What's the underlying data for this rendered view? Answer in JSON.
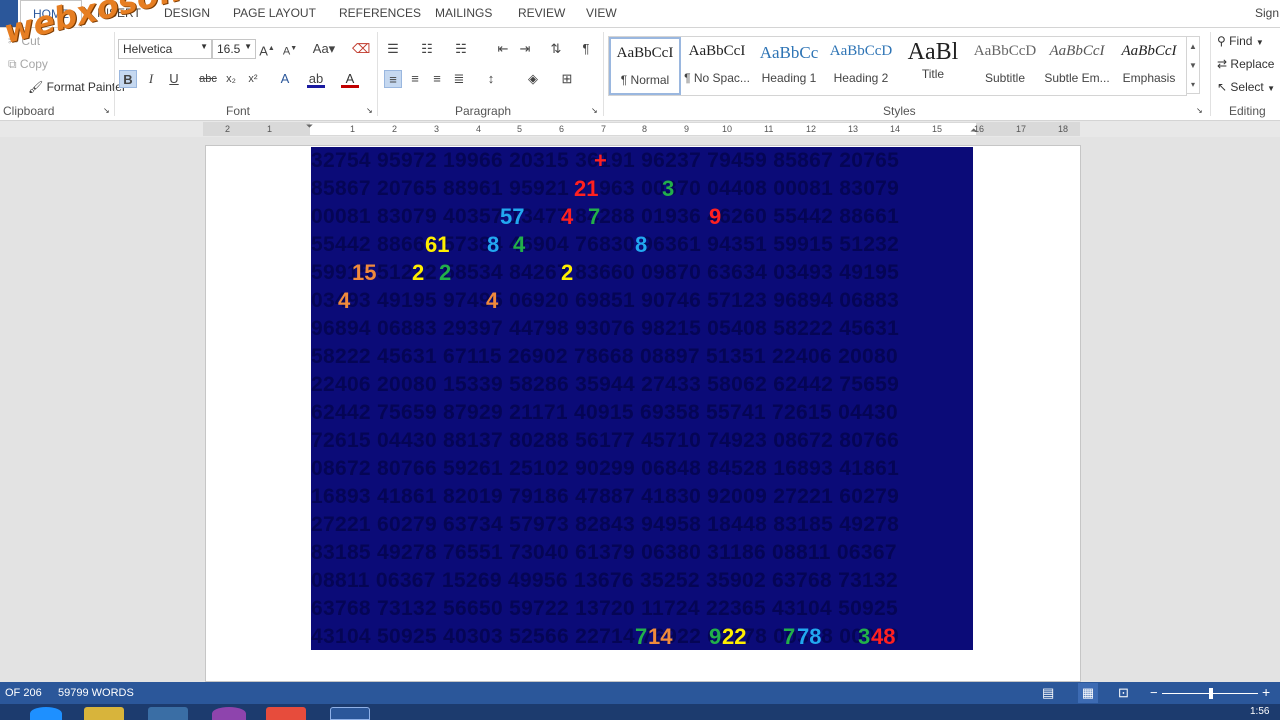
{
  "tabs": [
    "HOME",
    "INSERT",
    "DESIGN",
    "PAGE LAYOUT",
    "REFERENCES",
    "MAILINGS",
    "REVIEW",
    "VIEW"
  ],
  "sign_in": "Sign",
  "clipboard": {
    "cut": "Cut",
    "copy": "Copy",
    "format_painter": "Format Painter",
    "label": "Clipboard"
  },
  "font": {
    "name": "Helvetica",
    "size": "16.5",
    "label": "Font"
  },
  "paragraph": {
    "label": "Paragraph"
  },
  "styles": {
    "label": "Styles",
    "items": [
      {
        "preview": "AaBbCcI",
        "name": "¶ Normal"
      },
      {
        "preview": "AaBbCcI",
        "name": "¶ No Spac..."
      },
      {
        "preview": "AaBbCc",
        "name": "Heading 1"
      },
      {
        "preview": "AaBbCcD",
        "name": "Heading 2"
      },
      {
        "preview": "AaBl",
        "name": "Title"
      },
      {
        "preview": "AaBbCcD",
        "name": "Subtitle"
      },
      {
        "preview": "AaBbCcI",
        "name": "Subtle Em..."
      },
      {
        "preview": "AaBbCcI",
        "name": "Emphasis"
      }
    ]
  },
  "editing": {
    "find": "Find",
    "replace": "Replace",
    "select": "Select",
    "label": "Editing"
  },
  "ruler_numbers": [
    "2",
    "1",
    "1",
    "2",
    "3",
    "4",
    "5",
    "6",
    "7",
    "8",
    "9",
    "10",
    "11",
    "12",
    "13",
    "14",
    "15",
    "16",
    "17",
    "18"
  ],
  "grid_rows": [
    "32754 95972 19966 20315 36191 96237 79459 85867 20765",
    "85867 20765 88961 95921 71963 00370 04408 00081 83079",
    "00081 83079 40357 13477 84288 01936 46260 55442 88661",
    "55442 88661 57384 46904 76830 96361 94351 59915 51232",
    "59915 51232 58534 84267 83660 09870 63634 03493 49195",
    "03493 49195 97495 06920 69851 90746 57123 96894 06883",
    "96894 06883 29397 44798 93076 98215 05408 58222 45631",
    "58222 45631 67115 26902 78668 08897 51351 22406 20080",
    "22406 20080 15339 58286 35944 27433 58062 62442 75659",
    "62442 75659 87929 21171 40915 69358 55741 72615 04430",
    "72615 04430 88137 80288 56177 45710 74923 08672 80766",
    "08672 80766 59261 25102 90299 06848 84528 16893 41861",
    "16893 41861 82019 79186 47887 41830 92009 27221 60279",
    "27221 60279 63734 57973 82843 94958 18448 83185 49278",
    "83185 49278 76551 73040 61379 06380 31186 08811 06367",
    "08811 06367 15269 49956 13676 35252 35902 63768 73132",
    "63768 73132 56650 59722 13720 11724 22365 43104 50925",
    "43104 50925 40303 52566 22714 76922 62778 00348 00000"
  ],
  "highlights": [
    {
      "text": "+",
      "color": "#ff2020",
      "row": 0,
      "col": 594
    },
    {
      "text": "21",
      "color": "#ff2020",
      "row": 1,
      "col": 574
    },
    {
      "text": "3",
      "color": "#22b04a",
      "row": 1,
      "col": 662
    },
    {
      "text": "57",
      "color": "#22a8f0",
      "row": 2,
      "col": 500
    },
    {
      "text": "4",
      "color": "#ff2020",
      "row": 2,
      "col": 561
    },
    {
      "text": "7",
      "color": "#22b04a",
      "row": 2,
      "col": 588
    },
    {
      "text": "9",
      "color": "#ff2020",
      "row": 2,
      "col": 709
    },
    {
      "text": "61",
      "color": "#ffee00",
      "row": 3,
      "col": 425
    },
    {
      "text": "8",
      "color": "#22a8f0",
      "row": 3,
      "col": 487
    },
    {
      "text": "4",
      "color": "#22b04a",
      "row": 3,
      "col": 513
    },
    {
      "text": "8",
      "color": "#22a8f0",
      "row": 3,
      "col": 635
    },
    {
      "text": "15",
      "color": "#f08a3c",
      "row": 4,
      "col": 352
    },
    {
      "text": "2",
      "color": "#ffee00",
      "row": 4,
      "col": 412
    },
    {
      "text": "2",
      "color": "#22b04a",
      "row": 4,
      "col": 439
    },
    {
      "text": "2",
      "color": "#ffee00",
      "row": 4,
      "col": 561
    },
    {
      "text": "4",
      "color": "#f08a3c",
      "row": 5,
      "col": 338
    },
    {
      "text": "4",
      "color": "#f08a3c",
      "row": 5,
      "col": 486
    },
    {
      "text": "7",
      "color": "#22b04a",
      "row": 17,
      "col": 635
    },
    {
      "text": "14",
      "color": "#f08a3c",
      "row": 17,
      "col": 648
    },
    {
      "text": "9",
      "color": "#22b04a",
      "row": 17,
      "col": 709
    },
    {
      "text": "22",
      "color": "#ffee00",
      "row": 17,
      "col": 722
    },
    {
      "text": "7",
      "color": "#22b04a",
      "row": 17,
      "col": 783
    },
    {
      "text": "78",
      "color": "#22a8f0",
      "row": 17,
      "col": 797
    },
    {
      "text": "3",
      "color": "#22b04a",
      "row": 17,
      "col": 858
    },
    {
      "text": "48",
      "color": "#ff2020",
      "row": 17,
      "col": 871
    }
  ],
  "watermark": "webxoso.net",
  "status": {
    "page": "OF 206",
    "words": "59799 WORDS"
  },
  "clock": "1:56"
}
